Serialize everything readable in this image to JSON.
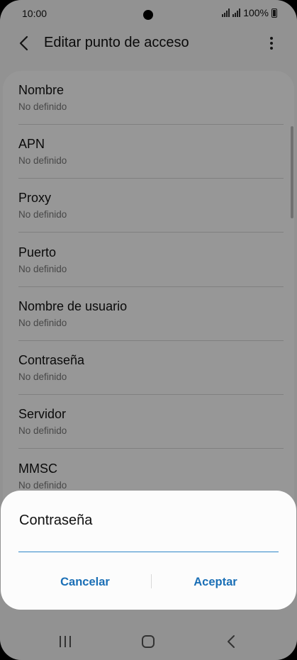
{
  "status_bar": {
    "time": "10:00",
    "battery": "100%"
  },
  "app_bar": {
    "title": "Editar punto de acceso",
    "back_icon": "back-chevron-icon",
    "menu_icon": "more-vert-icon"
  },
  "list": {
    "items": [
      {
        "title": "Nombre",
        "value": "No definido"
      },
      {
        "title": "APN",
        "value": "No definido"
      },
      {
        "title": "Proxy",
        "value": "No definido"
      },
      {
        "title": "Puerto",
        "value": "No definido"
      },
      {
        "title": "Nombre de usuario",
        "value": "No definido"
      },
      {
        "title": "Contraseña",
        "value": "No definido"
      },
      {
        "title": "Servidor",
        "value": "No definido"
      },
      {
        "title": "MMSC",
        "value": "No definido"
      }
    ]
  },
  "dialog": {
    "title": "Contraseña",
    "input_value": "",
    "cancel_label": "Cancelar",
    "accept_label": "Aceptar"
  },
  "colors": {
    "accent": "#1a6fb6",
    "input_underline": "#2f86c9"
  },
  "nav_bar": {
    "recents_icon": "recents-icon",
    "home_icon": "home-icon",
    "back_icon": "nav-back-icon"
  }
}
